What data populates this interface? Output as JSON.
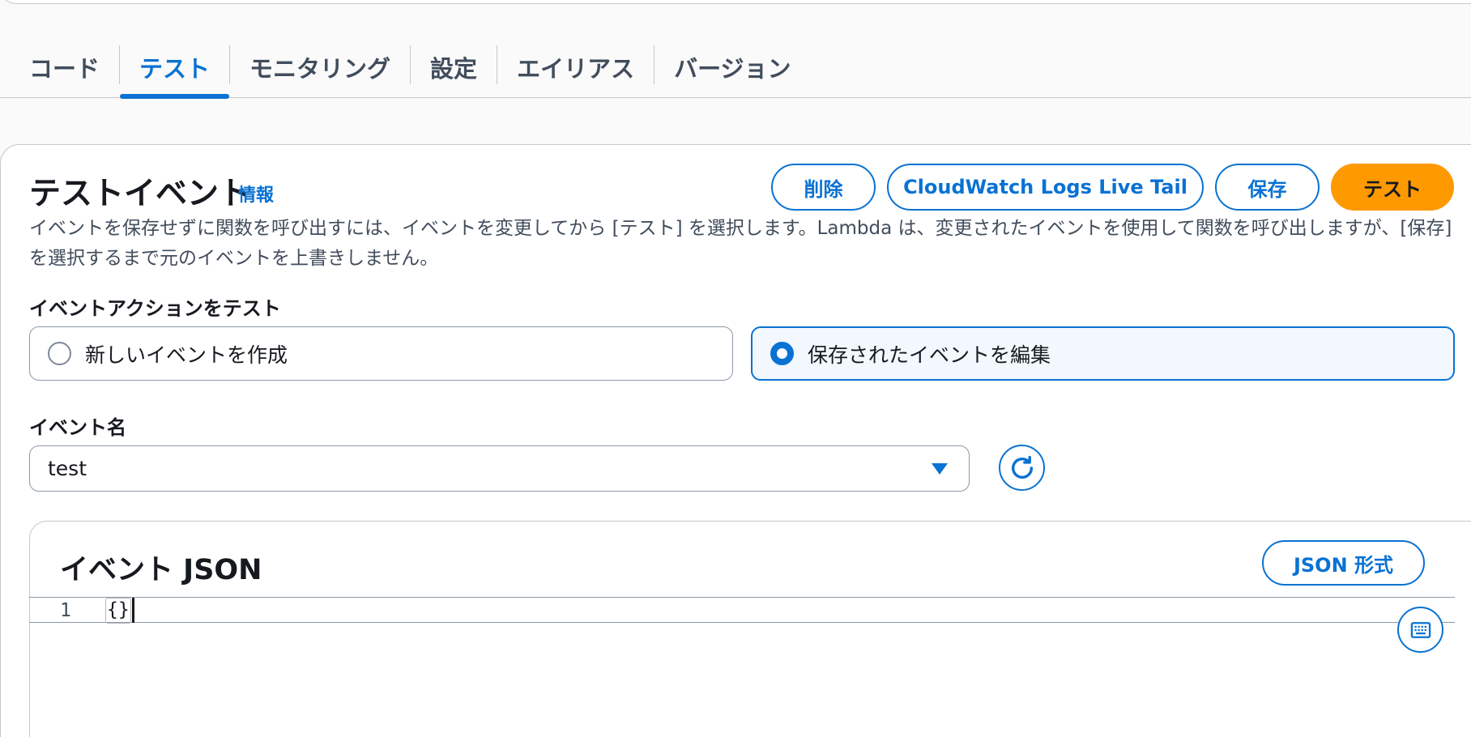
{
  "tabs": [
    {
      "label": "コード",
      "active": false
    },
    {
      "label": "テスト",
      "active": true
    },
    {
      "label": "モニタリング",
      "active": false
    },
    {
      "label": "設定",
      "active": false
    },
    {
      "label": "エイリアス",
      "active": false
    },
    {
      "label": "バージョン",
      "active": false
    }
  ],
  "test_panel": {
    "title": "テストイベント",
    "info_link": "情報",
    "description": "イベントを保存せずに関数を呼び出すには、イベントを変更してから [テスト] を選択します。Lambda は、変更されたイベントを使用して関数を呼び出しますが、[保存] を選択するまで元のイベントを上書きしません。",
    "buttons": {
      "delete": "削除",
      "live_tail": "CloudWatch Logs Live Tail",
      "save": "保存",
      "test": "テスト"
    },
    "event_action": {
      "label": "イベントアクションをテスト",
      "options": [
        {
          "label": "新しいイベントを作成",
          "selected": false
        },
        {
          "label": "保存されたイベントを編集",
          "selected": true
        }
      ]
    },
    "event_name": {
      "label": "イベント名",
      "value": "test"
    },
    "event_json": {
      "title": "イベント JSON",
      "format_button": "JSON 形式",
      "line_number": "1",
      "code": "{}"
    }
  },
  "colors": {
    "accent": "#0972d3",
    "primary_button": "#ff9900",
    "text": "#16191f",
    "secondary_text": "#414d5c"
  },
  "icons": [
    "radio-unchecked-icon",
    "radio-checked-icon",
    "caret-down-icon",
    "refresh-icon",
    "keyboard-icon"
  ]
}
